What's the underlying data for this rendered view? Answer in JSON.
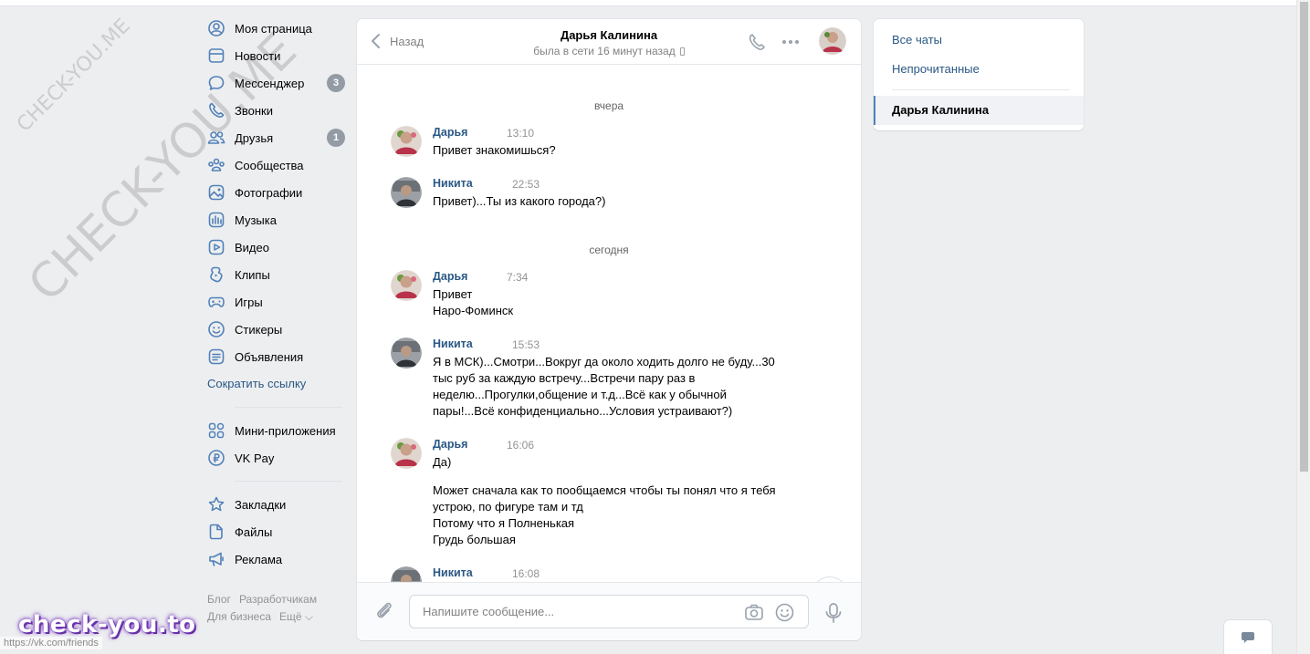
{
  "watermarks": {
    "small": "CHECK-YOU.ME",
    "large": "CHECK-YOU.ME",
    "brand": "check-you.to"
  },
  "status_url": "https://vk.com/friends",
  "leftnav": {
    "items": [
      {
        "label": "Моя страница",
        "icon": "user-icon"
      },
      {
        "label": "Новости",
        "icon": "news-icon"
      },
      {
        "label": "Мессенджер",
        "icon": "message-icon",
        "badge": "3"
      },
      {
        "label": "Звонки",
        "icon": "phone-icon"
      },
      {
        "label": "Друзья",
        "icon": "friends-icon",
        "badge": "1"
      },
      {
        "label": "Сообщества",
        "icon": "groups-icon"
      },
      {
        "label": "Фотографии",
        "icon": "photos-icon"
      },
      {
        "label": "Музыка",
        "icon": "music-icon"
      },
      {
        "label": "Видео",
        "icon": "video-icon"
      },
      {
        "label": "Клипы",
        "icon": "clips-icon"
      },
      {
        "label": "Игры",
        "icon": "games-icon"
      },
      {
        "label": "Стикеры",
        "icon": "stickers-icon"
      },
      {
        "label": "Объявления",
        "icon": "ads-icon"
      }
    ],
    "shortlink": "Сократить ссылку",
    "apps": [
      {
        "label": "Мини-приложения",
        "icon": "mini-apps-icon"
      },
      {
        "label": "VK Pay",
        "icon": "vkpay-icon"
      }
    ],
    "extra": [
      {
        "label": "Закладки",
        "icon": "bookmark-icon"
      },
      {
        "label": "Файлы",
        "icon": "files-icon"
      },
      {
        "label": "Реклама",
        "icon": "megaphone-icon"
      }
    ],
    "footer": {
      "blog": "Блог",
      "dev": "Разработчикам",
      "business": "Для бизнеса",
      "more": "Ещё ⌵"
    }
  },
  "chat": {
    "back_label": "Назад",
    "title": "Дарья Калинина",
    "subtitle": "была в сети 16 минут назад",
    "day1": "вчера",
    "day2": "сегодня",
    "messages": [
      {
        "name": "Дарья",
        "time": "13:10",
        "lines": [
          "Привет знакомишься?"
        ]
      },
      {
        "name": "Никита",
        "time": "22:53",
        "lines": [
          "Привет)...Ты из какого города?)"
        ]
      },
      {
        "name": "Дарья",
        "time": "7:34",
        "lines": [
          "Привет",
          "Наро-Фоминск"
        ]
      },
      {
        "name": "Никита",
        "time": "15:53",
        "lines": [
          "Я в МСК)...Смотри...Вокруг да около ходить долго не буду...30",
          "тыс руб за каждую встречу...Встречи пару раз в",
          "неделю...Прогулки,общение и т.д...Всё как у обычной",
          "пары!...Всё конфиденциально...Условия устраивают?)"
        ]
      },
      {
        "name": "Дарья",
        "time": "16:06",
        "lines": [
          "Да)",
          "",
          "Может сначала как то пообщаемся чтобы ты понял что я тебя",
          "устрою, по фигуре там и тд",
          "Потому что я Полненькая",
          "Грудь большая"
        ]
      },
      {
        "name": "Никита",
        "time": "16:08",
        "lines": []
      }
    ],
    "composer_placeholder": "Напишите сообщение..."
  },
  "rightpanel": {
    "all_chats": "Все чаты",
    "unread": "Непрочитанные",
    "active_chat": "Дарья Калинина"
  },
  "colors": {
    "accent": "#5181b8",
    "link": "#2a5885",
    "background": "#edeef0"
  }
}
